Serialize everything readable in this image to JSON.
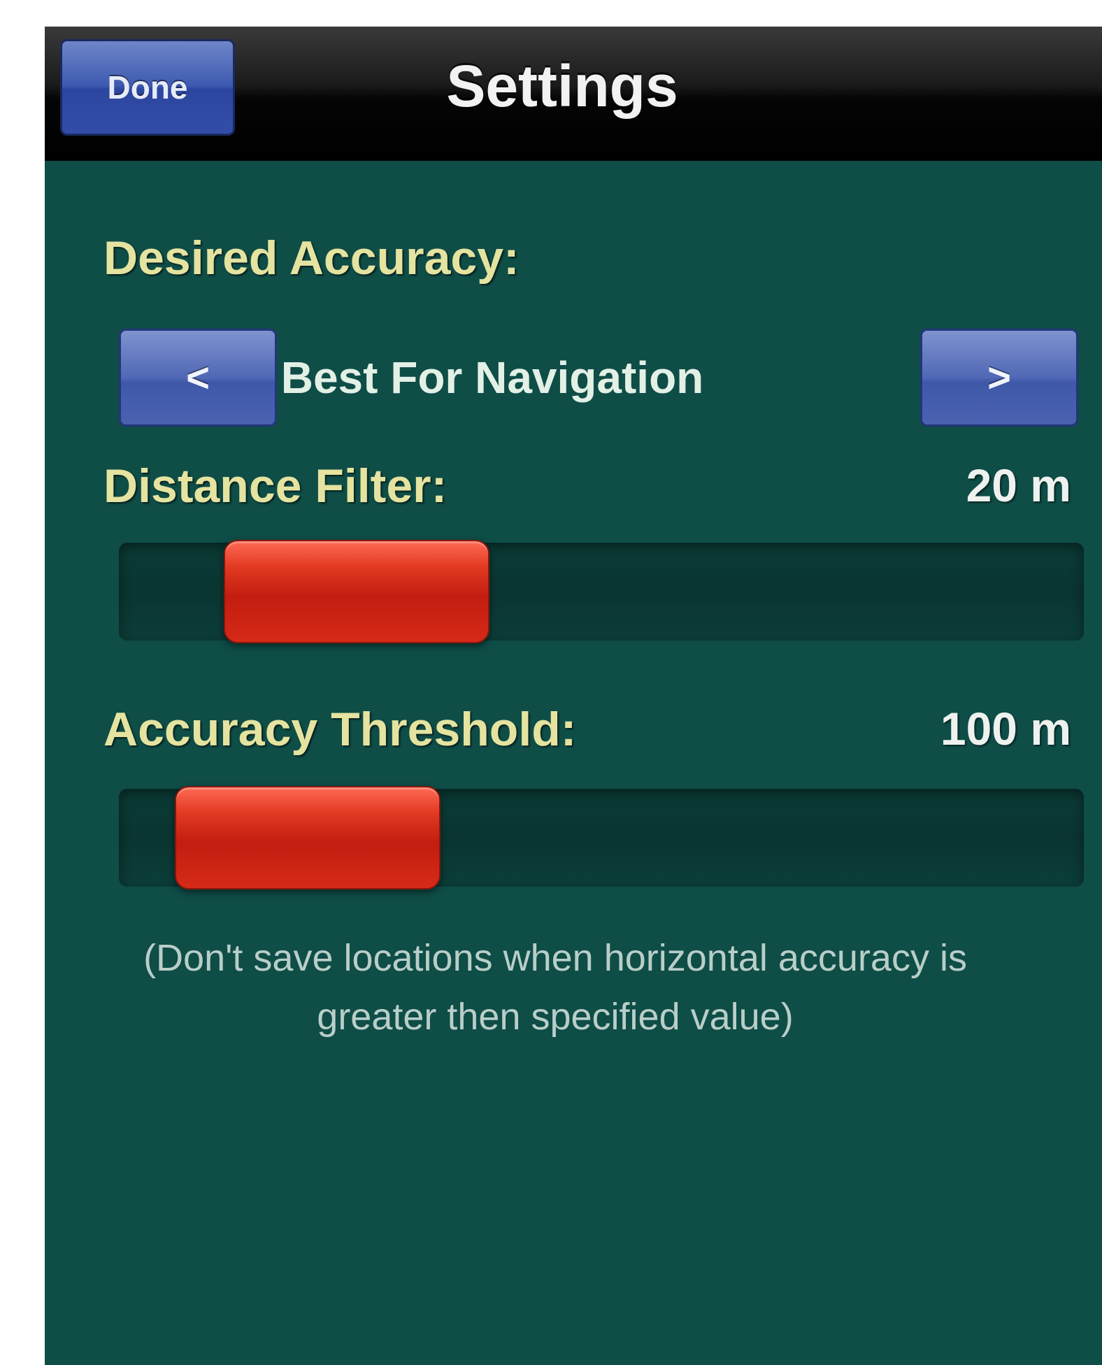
{
  "navbar": {
    "done_label": "Done",
    "title": "Settings"
  },
  "desired_accuracy": {
    "label": "Desired Accuracy:",
    "prev_label": "<",
    "next_label": ">",
    "value": "Best For Navigation"
  },
  "distance_filter": {
    "label": "Distance Filter:",
    "value": "20 m",
    "slider_position_fraction": 0.15
  },
  "accuracy_threshold": {
    "label": "Accuracy Threshold:",
    "value": "100 m",
    "slider_position_fraction": 0.08
  },
  "helper_text": "(Don't save locations when horizontal accuracy is greater then specified value)",
  "colors": {
    "background": "#0f4d47",
    "label_yellow": "#e4e3a0",
    "button_blue": "#3e5ab0",
    "slider_thumb_red": "#c21d10"
  }
}
